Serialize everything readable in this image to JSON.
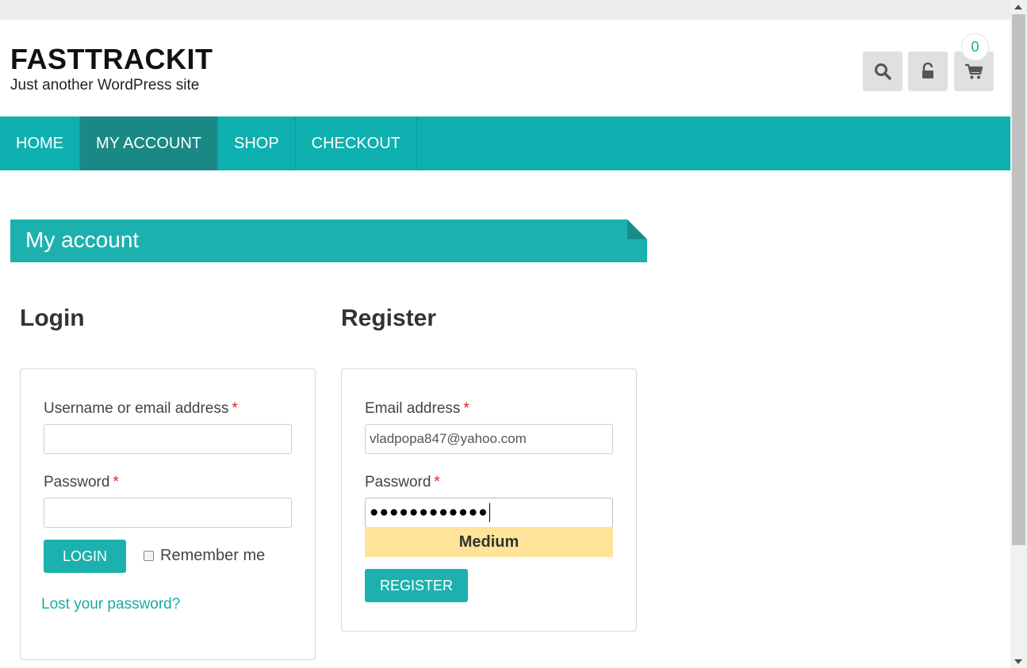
{
  "site": {
    "title": "FASTTRACKIT",
    "tagline": "Just another WordPress site"
  },
  "header": {
    "cart_count": "0",
    "icons": [
      "search-icon",
      "unlock-icon",
      "cart-icon"
    ]
  },
  "nav": {
    "items": [
      {
        "label": "HOME",
        "active": false
      },
      {
        "label": "MY ACCOUNT",
        "active": true
      },
      {
        "label": "SHOP",
        "active": false
      },
      {
        "label": "CHECKOUT",
        "active": false
      }
    ]
  },
  "page": {
    "title": "My account"
  },
  "login": {
    "heading": "Login",
    "username_label": "Username or email address",
    "username_value": "",
    "password_label": "Password",
    "password_value": "",
    "required_mark": "*",
    "submit_label": "LOGIN",
    "remember_label": "Remember me",
    "remember_checked": false,
    "lost_password_label": "Lost your password?"
  },
  "register": {
    "heading": "Register",
    "email_label": "Email address",
    "email_value": "vladpopa847@yahoo.com",
    "password_label": "Password",
    "password_masked": "●●●●●●●●●●●●",
    "required_mark": "*",
    "strength_label": "Medium",
    "submit_label": "REGISTER"
  },
  "colors": {
    "accent": "#0eb1b0",
    "nav_active": "#1a8986",
    "strength_medium": "#ffe399",
    "required": "#e02020"
  }
}
